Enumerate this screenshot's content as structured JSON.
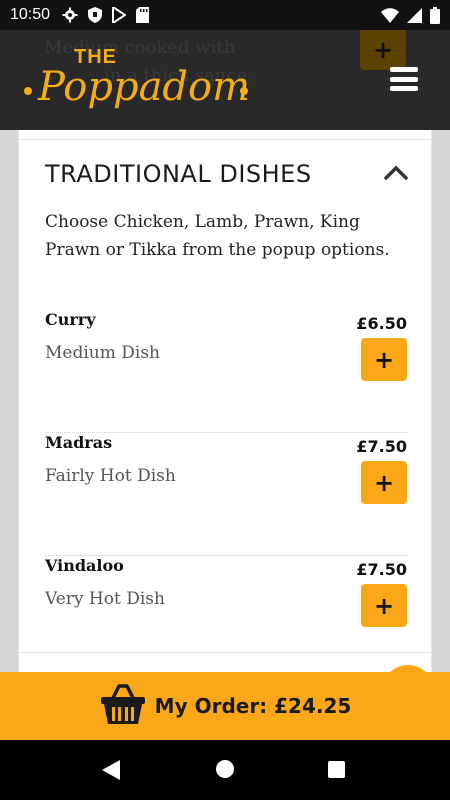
{
  "status_bar": {
    "time": "10:50",
    "icons": [
      "gear-icon",
      "shield-icon",
      "play-store-icon",
      "sd-card-icon"
    ],
    "right_icons": [
      "wifi-icon",
      "signal-icon",
      "battery-icon"
    ]
  },
  "header": {
    "behind_text_line1": "Medium cooked with",
    "behind_text_line2": "in a thick sauce.",
    "behind_button": "+",
    "logo_the": "THE",
    "logo_name": "Poppadom",
    "menu_icon": "hamburger-menu-icon"
  },
  "section": {
    "title": "TRADITIONAL DISHES",
    "collapse_icon": "chevron-up-icon",
    "description": "Choose Chicken, Lamb, Prawn, King Prawn or Tikka from the popup options."
  },
  "items": [
    {
      "name": "Curry",
      "description": "Medium Dish",
      "price": "£6.50",
      "add_label": "+"
    },
    {
      "name": "Madras",
      "description": "Fairly Hot Dish",
      "price": "£7.50",
      "add_label": "+"
    },
    {
      "name": "Vindaloo",
      "description": "Very Hot Dish",
      "price": "£7.50",
      "add_label": "+"
    }
  ],
  "order_bar": {
    "label": "My Order: £24.25",
    "icon": "basket-icon"
  },
  "nav_bar": {
    "icons": [
      "back-icon",
      "home-icon",
      "recents-icon"
    ]
  },
  "colors": {
    "accent": "#fba818",
    "header_bg": "#161616",
    "logo": "#f5ad17"
  }
}
